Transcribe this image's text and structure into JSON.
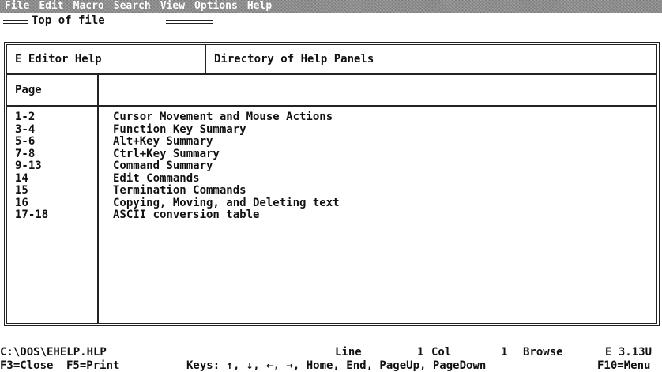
{
  "menu": [
    "File",
    "Edit",
    "Macro",
    "Search",
    "View",
    "Options",
    "Help"
  ],
  "top_of_file": "Top of file",
  "header": {
    "left": "E Editor Help",
    "right": "Directory of Help Panels"
  },
  "column_header": "Page",
  "entries": [
    {
      "page": "1-2",
      "desc": "Cursor Movement and Mouse Actions"
    },
    {
      "page": "3-4",
      "desc": "Function Key Summary"
    },
    {
      "page": "5-6",
      "desc": "Alt+Key Summary"
    },
    {
      "page": "7-8",
      "desc": "Ctrl+Key Summary"
    },
    {
      "page": "9-13",
      "desc": "Command Summary"
    },
    {
      "page": "14",
      "desc": "Edit Commands"
    },
    {
      "page": "15",
      "desc": "Termination Commands"
    },
    {
      "page": "16",
      "desc": "Copying, Moving, and Deleting text"
    },
    {
      "page": "17-18",
      "desc": "ASCII conversion table"
    }
  ],
  "status": {
    "file": "C:\\DOS\\EHELP.HLP",
    "line_label": "Line",
    "line_value": "1",
    "col_label": "Col",
    "col_value": "1",
    "mode": "Browse",
    "version": "E 3.13U"
  },
  "keys": {
    "close": "F3=Close",
    "print": "F5=Print",
    "nav": "Keys: ↑, ↓, ←, →, Home, End, PageUp, PageDown",
    "menu": "F10=Menu"
  }
}
